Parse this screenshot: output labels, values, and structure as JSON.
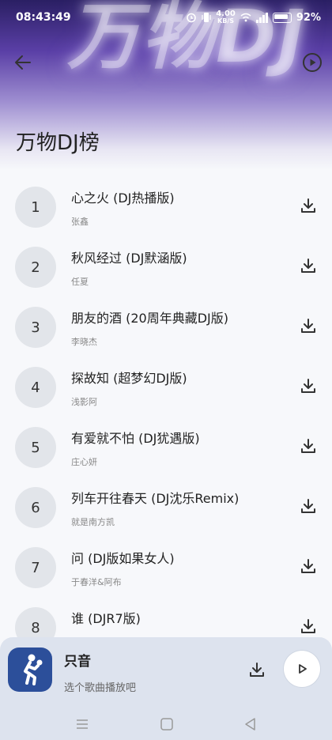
{
  "status_bar": {
    "time": "08:43:49",
    "net_speed_top": "4.00",
    "net_speed_bottom": "KB/S",
    "battery": "92%"
  },
  "header": {
    "background_word": "万物DJ",
    "title": "万物DJ榜",
    "back_icon": "arrow-left-icon",
    "play_icon": "play-circle-icon"
  },
  "songs": [
    {
      "rank": "1",
      "title": "心之火 (DJ热播版)",
      "artist": "张鑫"
    },
    {
      "rank": "2",
      "title": "秋风经过 (DJ默涵版)",
      "artist": "任夏"
    },
    {
      "rank": "3",
      "title": "朋友的酒 (20周年典藏DJ版)",
      "artist": "李晓杰"
    },
    {
      "rank": "4",
      "title": "探故知 (超梦幻DJ版)",
      "artist": "浅影阿"
    },
    {
      "rank": "5",
      "title": "有爱就不怕 (DJ犹遇版)",
      "artist": "庄心妍"
    },
    {
      "rank": "6",
      "title": "列车开往春天 (DJ沈乐Remix)",
      "artist": "就是南方凯"
    },
    {
      "rank": "7",
      "title": "问 (DJ版如果女人)",
      "artist": "于春洋&阿布"
    },
    {
      "rank": "8",
      "title": "谁 (DJR7版)",
      "artist": ""
    }
  ],
  "player": {
    "title": "只音",
    "subtitle": "选个歌曲播放吧"
  },
  "colors": {
    "header_dark": "#2a1f63",
    "header_mid": "#5a3fa6",
    "rank_bg": "#e2e5ea",
    "player_bg": "#dde3ee",
    "cover_bg": "#2c4f9a"
  }
}
